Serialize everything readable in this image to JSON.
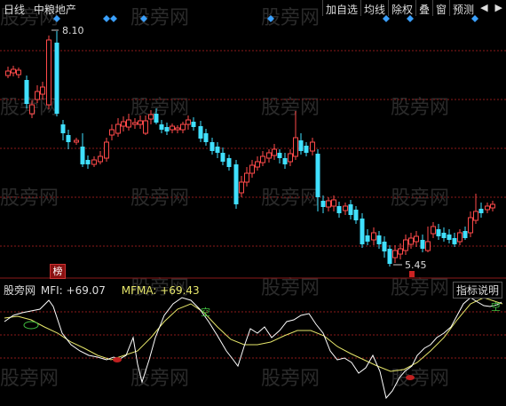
{
  "header": {
    "period": "日线",
    "stock": "中粮地产"
  },
  "toolbar": {
    "items": [
      "加自选",
      "均线",
      "除权",
      "叠",
      "窗",
      "预测"
    ],
    "arrows": [
      "◀",
      "▶"
    ]
  },
  "watermark": "股旁网",
  "price_chart": {
    "high_label": "8.10",
    "low_label": "5.45",
    "badge": "榜"
  },
  "indicator": {
    "mfi_label": "MFI:",
    "mfi_value": "+69.07",
    "mfma_label": "MFMA:",
    "mfma_value": "+69.43",
    "help_label": "指标说明",
    "signal_empty": "空"
  },
  "colors": {
    "up": "#ff4a4a",
    "down": "#40e0ff",
    "mfi": "#ffffff",
    "mfma": "#e6e66a",
    "grid": "#8b1a1a",
    "marker": "#3aa0ff"
  }
}
